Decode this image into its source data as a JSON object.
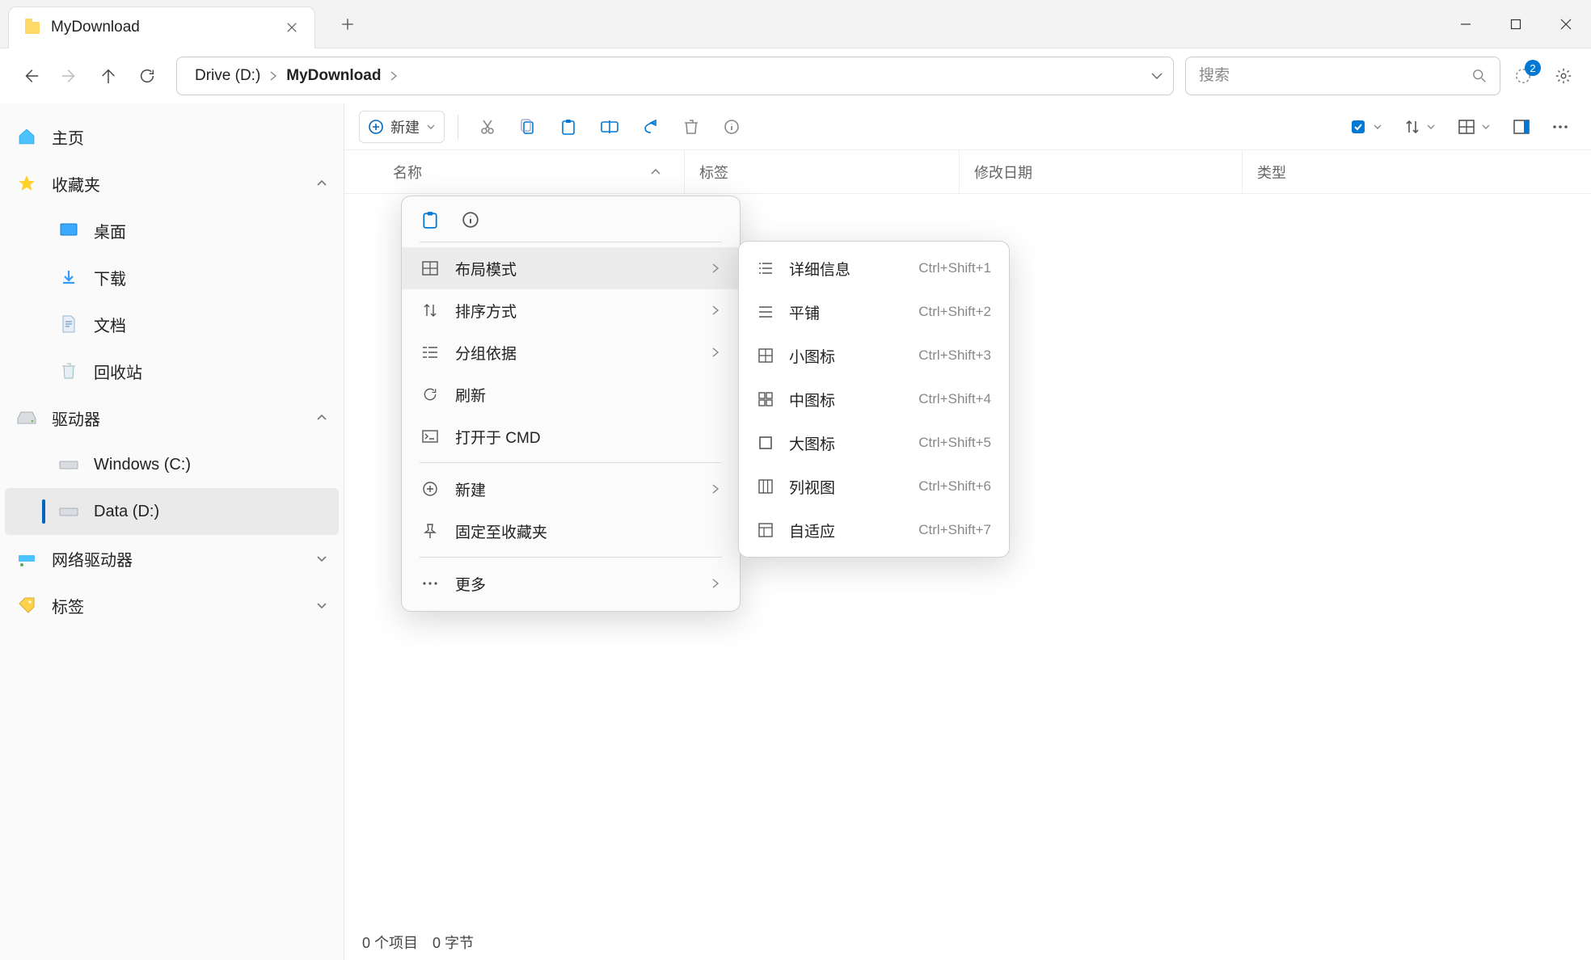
{
  "tab": {
    "title": "MyDownload"
  },
  "breadcrumb": {
    "root": "Drive (D:)",
    "current": "MyDownload"
  },
  "search": {
    "placeholder": "搜索"
  },
  "badge": "2",
  "toolbar": {
    "new": "新建"
  },
  "sidebar": {
    "home": "主页",
    "favorites": "收藏夹",
    "fav_items": [
      "桌面",
      "下载",
      "文档",
      "回收站"
    ],
    "drives": "驱动器",
    "drive_items": [
      "Windows (C:)",
      "Data (D:)"
    ],
    "network": "网络驱动器",
    "tags": "标签"
  },
  "columns": {
    "name": "名称",
    "tags": "标签",
    "date": "修改日期",
    "type": "类型"
  },
  "status": {
    "items": "0 个项目",
    "size": "0 字节"
  },
  "context": {
    "layout": "布局模式",
    "sort": "排序方式",
    "group": "分组依据",
    "refresh": "刷新",
    "open_cmd": "打开于 CMD",
    "new": "新建",
    "pin_fav": "固定至收藏夹",
    "more": "更多"
  },
  "submenu": [
    {
      "label": "详细信息",
      "shortcut": "Ctrl+Shift+1"
    },
    {
      "label": "平铺",
      "shortcut": "Ctrl+Shift+2"
    },
    {
      "label": "小图标",
      "shortcut": "Ctrl+Shift+3"
    },
    {
      "label": "中图标",
      "shortcut": "Ctrl+Shift+4"
    },
    {
      "label": "大图标",
      "shortcut": "Ctrl+Shift+5"
    },
    {
      "label": "列视图",
      "shortcut": "Ctrl+Shift+6"
    },
    {
      "label": "自适应",
      "shortcut": "Ctrl+Shift+7"
    }
  ]
}
